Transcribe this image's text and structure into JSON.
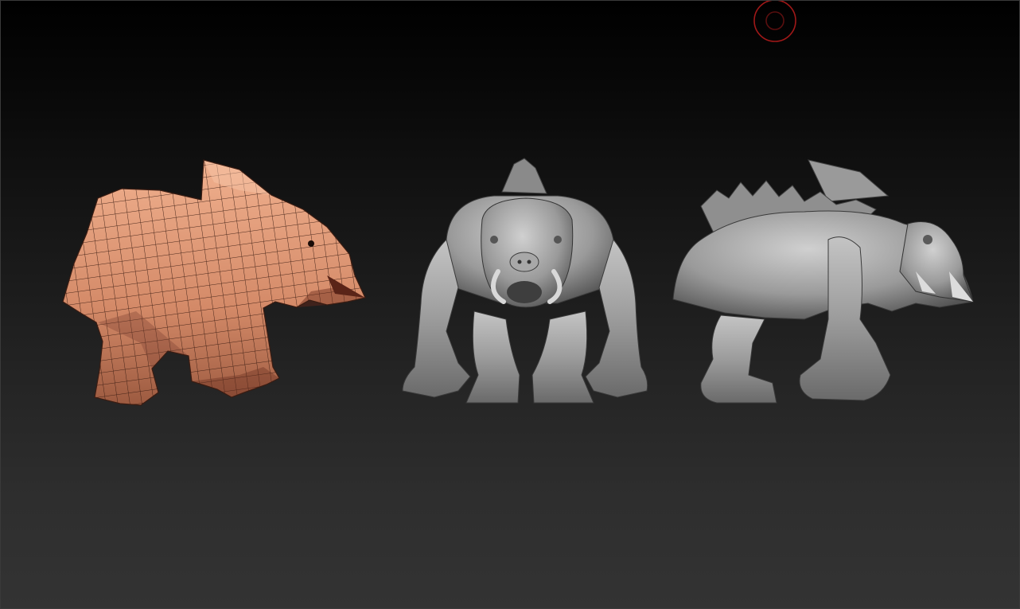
{
  "canvas": {
    "background_top": "#000000",
    "background_bottom": "#333333"
  },
  "brush_cursor": {
    "icon": "brush-cursor-icon",
    "color": "#a01818"
  },
  "models": [
    {
      "name": "lowpoly-wireframe-creature",
      "view": "side",
      "material_color": "#d99070",
      "wire_color": "#3a1c12"
    },
    {
      "name": "sculpted-creature-front",
      "view": "front",
      "material_color": "#9a9a9a"
    },
    {
      "name": "sculpted-creature-side",
      "view": "side",
      "material_color": "#9a9a9a"
    }
  ]
}
